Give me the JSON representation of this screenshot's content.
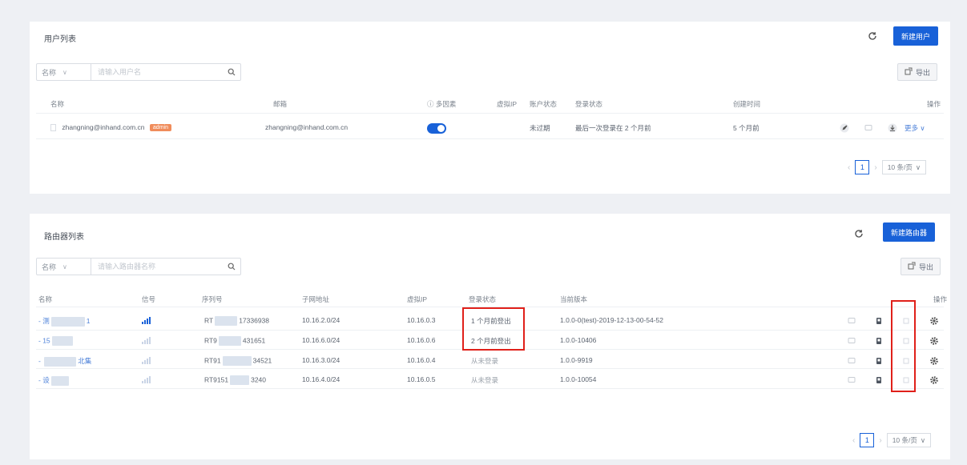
{
  "users_panel": {
    "title": "用户列表",
    "create_button": "新建用户",
    "search": {
      "type_label": "名称",
      "placeholder": "请输入用户名"
    },
    "export_label": "导出",
    "columns": {
      "name": "名称",
      "email": "邮箱",
      "mfa": "多因素",
      "virtual_ip": "虚拟IP",
      "account_status": "账户状态",
      "login_status": "登录状态",
      "created": "创建时间",
      "actions": "操作"
    },
    "rows": [
      {
        "name": "zhangning@inhand.com.cn",
        "badge": "admin",
        "email": "zhangning@inhand.com.cn",
        "mfa_enabled": true,
        "virtual_ip": "",
        "account_status": "未过期",
        "login_status": "最后一次登录在 2 个月前",
        "created": "5 个月前",
        "more_label": "更多"
      }
    ],
    "pagination": {
      "current_page": "1",
      "page_size": "10 条/页"
    }
  },
  "routers_panel": {
    "title": "路由器列表",
    "create_button": "新建路由器",
    "search": {
      "type_label": "名称",
      "placeholder": "请输入路由器名称"
    },
    "export_label": "导出",
    "columns": {
      "name": "名称",
      "signal": "信号",
      "serial": "序列号",
      "subnet": "子网地址",
      "virtual_ip": "虚拟IP",
      "login_status": "登录状态",
      "version": "当前版本",
      "actions": "操作"
    },
    "rows": [
      {
        "name_prefix": "测",
        "name_suffix": "1",
        "serial_prefix": "RT",
        "serial_suffix": "17336938",
        "subnet": "10.16.2.0/24",
        "virtual_ip": "10.16.0.3",
        "login_status": "1 个月前登出",
        "version": "1.0.0-0(test)-2019-12-13-00-54-52",
        "signal_level": 4
      },
      {
        "name_prefix": "15",
        "name_suffix": "",
        "serial_prefix": "RT9",
        "serial_suffix": "431651",
        "subnet": "10.16.6.0/24",
        "virtual_ip": "10.16.0.6",
        "login_status": "2 个月前登出",
        "version": "1.0.0-10406",
        "signal_level": 0
      },
      {
        "name_prefix": "",
        "name_suffix": "北集",
        "serial_prefix": "RT91",
        "serial_suffix": "34521",
        "subnet": "10.16.3.0/24",
        "virtual_ip": "10.16.0.4",
        "login_status": "从未登录",
        "version": "1.0.0-9919",
        "signal_level": 0
      },
      {
        "name_prefix": "设",
        "name_suffix": "",
        "serial_prefix": "RT9151",
        "serial_suffix": "3240",
        "subnet": "10.16.4.0/24",
        "virtual_ip": "10.16.0.5",
        "login_status": "从未登录",
        "version": "1.0.0-10054",
        "signal_level": 0
      }
    ],
    "pagination": {
      "current_page": "1",
      "page_size": "10 条/页"
    }
  },
  "colors": {
    "primary": "#1861d8",
    "highlight_box": "#e0201a",
    "badge": "#f08c5b",
    "link": "#4a7fd8"
  }
}
